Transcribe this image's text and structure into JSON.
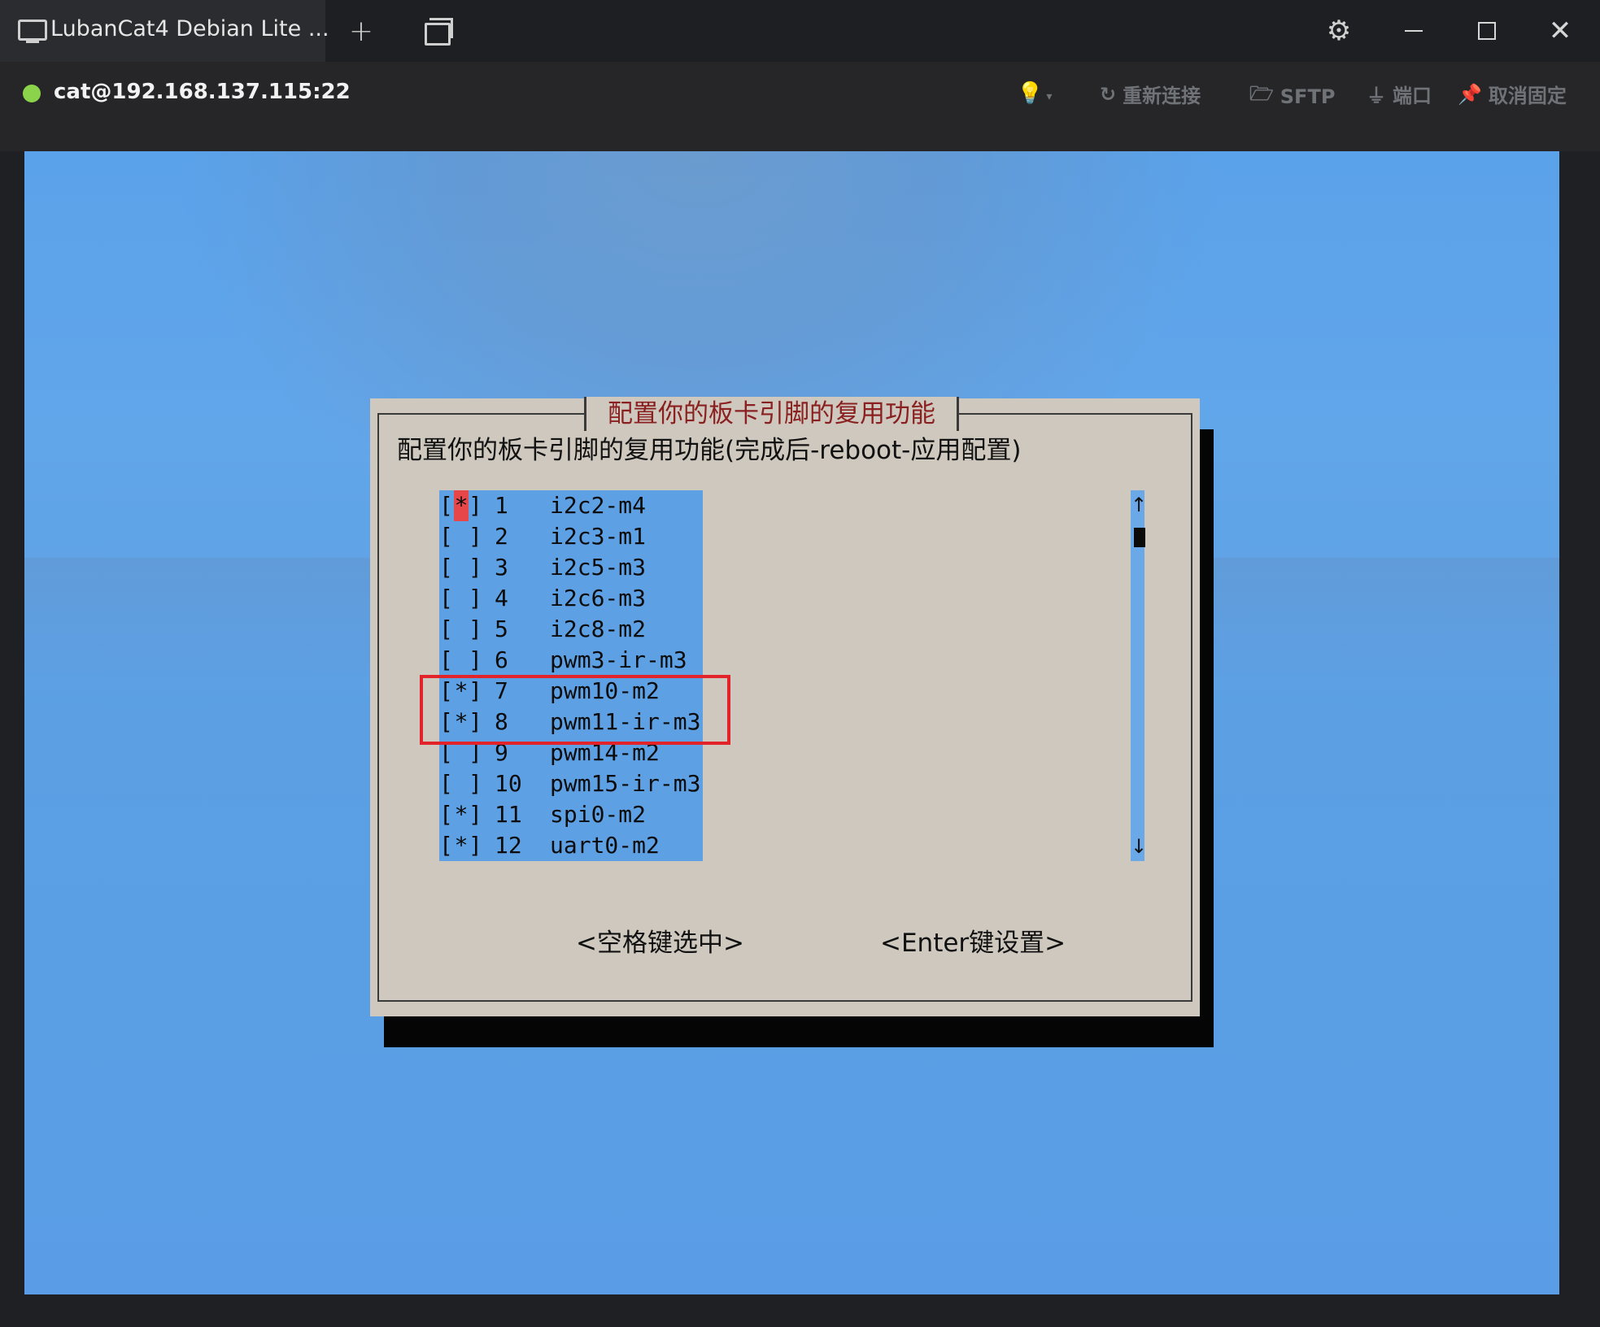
{
  "window": {
    "tab_title": "LubanCat4 Debian Lite ...",
    "new_tab_glyph": "+",
    "close_glyph": "✕",
    "gear_glyph": "⚙"
  },
  "session": {
    "status_color": "#8bd34a",
    "host": "cat@192.168.137.115:22",
    "tools": {
      "reconnect": "重新连接",
      "sftp": "SFTP",
      "port": "端口",
      "unpin": "取消固定"
    }
  },
  "dialog": {
    "title": "配置你的板卡引脚的复用功能",
    "description": "配置你的板卡引脚的复用功能(完成后-reboot-应用配置)",
    "items": [
      {
        "mark": "*",
        "num": "1",
        "label": "i2c2-m4"
      },
      {
        "mark": " ",
        "num": "2",
        "label": "i2c3-m1"
      },
      {
        "mark": " ",
        "num": "3",
        "label": "i2c5-m3"
      },
      {
        "mark": " ",
        "num": "4",
        "label": "i2c6-m3"
      },
      {
        "mark": " ",
        "num": "5",
        "label": "i2c8-m2"
      },
      {
        "mark": " ",
        "num": "6",
        "label": "pwm3-ir-m3"
      },
      {
        "mark": "*",
        "num": "7",
        "label": "pwm10-m2"
      },
      {
        "mark": "*",
        "num": "8",
        "label": "pwm11-ir-m3"
      },
      {
        "mark": " ",
        "num": "9",
        "label": "pwm14-m2"
      },
      {
        "mark": " ",
        "num": "10",
        "label": "pwm15-ir-m3"
      },
      {
        "mark": "*",
        "num": "11",
        "label": "spi0-m2"
      },
      {
        "mark": "*",
        "num": "12",
        "label": "uart0-m2"
      }
    ],
    "scroll_up": "↑",
    "scroll_down": "↓",
    "select_button": "<空格键选中>",
    "ok_button": "<Enter键设置>"
  },
  "colors": {
    "title_text": "#8b2020",
    "cursor": "#e8474a",
    "highlight_box": "#e2232a",
    "list_bg": "#5ea0e4"
  }
}
